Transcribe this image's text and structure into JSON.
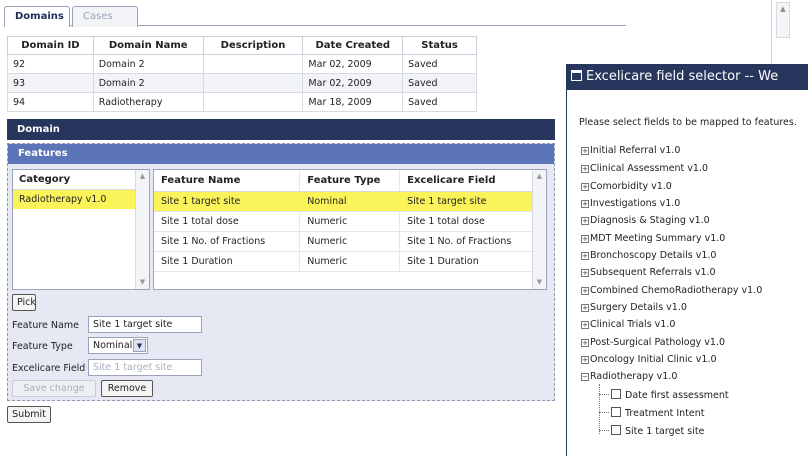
{
  "tabs": [
    {
      "label": "Domains",
      "active": true
    },
    {
      "label": "Cases",
      "active": false
    }
  ],
  "domains_table": {
    "headers": [
      "Domain ID",
      "Domain Name",
      "Description",
      "Date Created",
      "Status"
    ],
    "rows": [
      [
        "92",
        "Domain 2",
        "",
        "Mar 02, 2009",
        "Saved"
      ],
      [
        "93",
        "Domain 2",
        "",
        "Mar 02, 2009",
        "Saved"
      ],
      [
        "94",
        "Radiotherapy",
        "",
        "Mar 18, 2009",
        "Saved"
      ]
    ]
  },
  "domain_section": {
    "title": "Domain"
  },
  "features_section": {
    "title": "Features",
    "category_header": "Category",
    "categories": [
      "Radiotherapy v1.0"
    ],
    "feature_headers": [
      "Feature Name",
      "Feature Type",
      "Excelicare Field"
    ],
    "features": [
      [
        "Site 1 target site",
        "Nominal",
        "Site 1 target site"
      ],
      [
        "Site 1 total dose",
        "Numeric",
        "Site 1 total dose"
      ],
      [
        "Site 1 No. of Fractions",
        "Numeric",
        "Site 1 No. of Fractions"
      ],
      [
        "Site 1 Duration",
        "Numeric",
        "Site 1 Duration"
      ]
    ],
    "pick_label": "Pick",
    "feature_name_label": "Feature Name",
    "feature_name_value": "Site 1 target site",
    "feature_type_label": "Feature Type",
    "feature_type_value": "Nominal",
    "excelicare_field_label": "Excelicare Field",
    "excelicare_field_placeholder": "Site 1 target site",
    "save_change_label": "Save change",
    "remove_label": "Remove"
  },
  "submit_label": "Submit",
  "popup": {
    "title": "Excelicare field selector -- We",
    "instruction": "Please select fields to be mapped to features.",
    "tree": [
      {
        "label": "Initial Referral v1.0",
        "expanded": false
      },
      {
        "label": "Clinical Assessment v1.0",
        "expanded": false
      },
      {
        "label": "Comorbidity v1.0",
        "expanded": false
      },
      {
        "label": "Investigations v1.0",
        "expanded": false
      },
      {
        "label": "Diagnosis & Staging v1.0",
        "expanded": false
      },
      {
        "label": "MDT Meeting Summary v1.0",
        "expanded": false
      },
      {
        "label": "Bronchoscopy Details v1.0",
        "expanded": false
      },
      {
        "label": "Subsequent Referrals v1.0",
        "expanded": false
      },
      {
        "label": "Combined ChemoRadiotherapy v1.0",
        "expanded": false
      },
      {
        "label": "Surgery Details v1.0",
        "expanded": false
      },
      {
        "label": "Clinical Trials v1.0",
        "expanded": false
      },
      {
        "label": "Post-Surgical Pathology v1.0",
        "expanded": false
      },
      {
        "label": "Oncology Initial Clinic v1.0",
        "expanded": false
      },
      {
        "label": "Radiotherapy v1.0",
        "expanded": true
      }
    ],
    "children": [
      "Date first assessment",
      "Treatment Intent",
      "Site 1 target site"
    ]
  },
  "colors": {
    "navy": "#27365c",
    "blue_bar": "#5c74b8",
    "panel_bg": "#e6e9f3",
    "selected": "#fbf35a"
  },
  "icons": {
    "expand": "plus-box-icon",
    "collapse": "minus-box-icon",
    "select_arrow": "chevron-down-icon",
    "window": "window-icon"
  }
}
